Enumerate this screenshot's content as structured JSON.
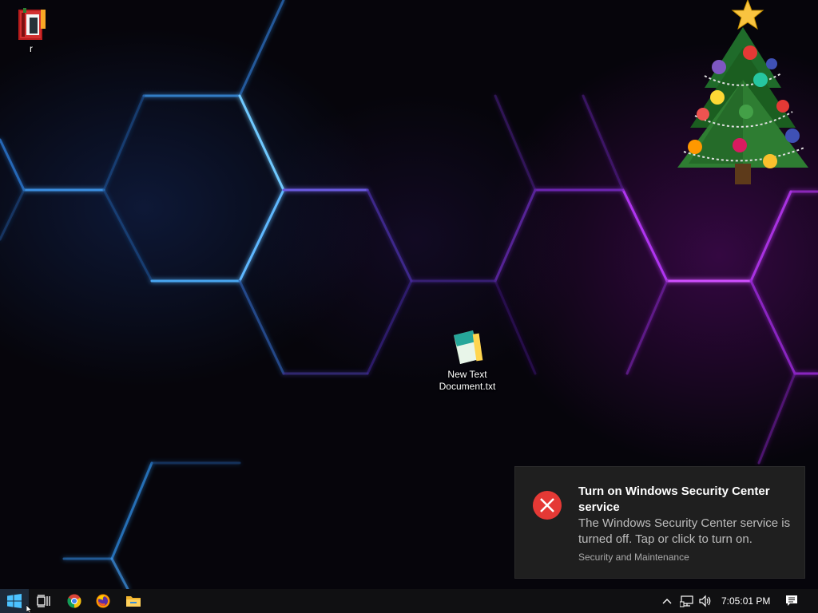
{
  "desktop": {
    "icons": [
      {
        "label": "r",
        "icon": "winrar-archive-icon"
      },
      {
        "label": "New Text Document.txt",
        "label_line1": "New Text",
        "label_line2": "Document.txt",
        "icon": "notepad-file-icon"
      }
    ],
    "widgets": [
      "christmas-tree-decoration"
    ]
  },
  "notification": {
    "title": "Turn on Windows Security Center service",
    "body": "The Windows Security Center service is turned off. Tap or click to turn on.",
    "source": "Security and Maintenance",
    "icon": "error-x-icon",
    "accent": "#e53935"
  },
  "taskbar": {
    "pinned": [
      "start-windows-icon",
      "task-view-icon",
      "chrome-icon",
      "firefox-icon",
      "file-explorer-icon"
    ],
    "tray": {
      "icons": [
        "chevron-up-icon",
        "network-icon",
        "volume-icon"
      ],
      "clock": "7:05:01 PM",
      "action_center_icon": "notification-center-icon"
    }
  },
  "colors": {
    "hex_blue": "#5fb8ff",
    "hex_purple": "#c040ff",
    "taskbar_bg": "#101012",
    "toast_bg": "#1f1f1f"
  }
}
